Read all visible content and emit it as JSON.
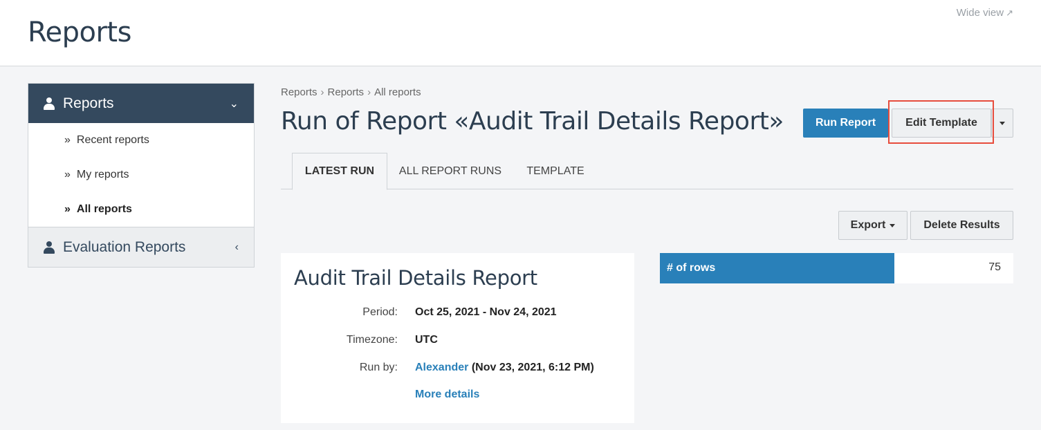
{
  "header": {
    "title": "Reports",
    "wide_view": "Wide view",
    "wide_view_icon": "↗"
  },
  "sidebar": {
    "section_label": "Reports",
    "items": [
      {
        "label": "Recent reports"
      },
      {
        "label": "My reports"
      },
      {
        "label": "All reports"
      }
    ],
    "second_section_label": "Evaluation Reports",
    "bullet": "»",
    "chevron_open": "⌄",
    "chevron_closed": "‹"
  },
  "breadcrumb": {
    "items": [
      "Reports",
      "Reports",
      "All reports"
    ],
    "separator": "›"
  },
  "main": {
    "title": "Run of Report «Audit Trail Details Report»"
  },
  "toolbar": {
    "run_label": "Run Report",
    "edit_label": "Edit Template"
  },
  "tabs": [
    {
      "label": "LATEST RUN"
    },
    {
      "label": "ALL REPORT RUNS"
    },
    {
      "label": "TEMPLATE"
    }
  ],
  "actions": {
    "export_label": "Export",
    "delete_label": "Delete Results"
  },
  "details": {
    "title": "Audit Trail Details Report",
    "period_label": "Period:",
    "period_value": "Oct 25, 2021 - Nov 24, 2021",
    "timezone_label": "Timezone:",
    "timezone_value": "UTC",
    "run_by_label": "Run by:",
    "run_by_user": "Alexander",
    "run_by_time": "(Nov 23, 2021, 6:12 PM)",
    "more_details": "More details"
  },
  "stats": {
    "rows_label": "# of rows",
    "rows_value": "75"
  },
  "colors": {
    "primary": "#2980b9",
    "sidebar_dark": "#34495e",
    "highlight": "#e74c3c"
  }
}
